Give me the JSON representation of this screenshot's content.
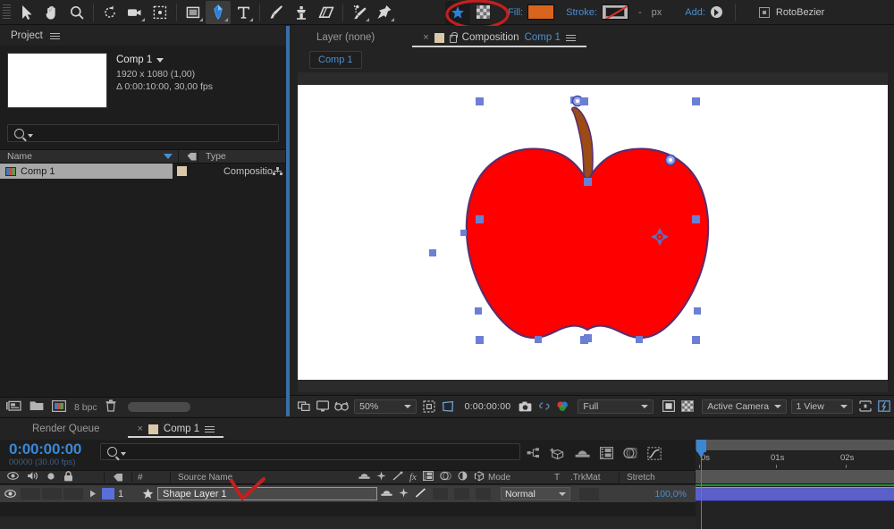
{
  "toolbar": {
    "tools": [
      {
        "name": "selection-tool",
        "icon": "arrow",
        "active": false
      },
      {
        "name": "hand-tool",
        "icon": "hand",
        "active": false
      },
      {
        "name": "zoom-tool",
        "icon": "magnifier",
        "active": false
      },
      {
        "name": "rotation-tool",
        "icon": "rotate",
        "active": false
      },
      {
        "name": "camera-tool",
        "icon": "camera",
        "active": false
      },
      {
        "name": "anchor-point-tool",
        "icon": "anchor-box",
        "active": false
      },
      {
        "name": "shape-tool",
        "icon": "rectangle",
        "active": false
      },
      {
        "name": "pen-tool",
        "icon": "pen",
        "active": true
      },
      {
        "name": "type-tool",
        "icon": "text-T",
        "active": false
      },
      {
        "name": "brush-tool",
        "icon": "brush",
        "active": false
      },
      {
        "name": "clone-stamp-tool",
        "icon": "stamp",
        "active": false
      },
      {
        "name": "eraser-tool",
        "icon": "eraser",
        "active": false
      },
      {
        "name": "roto-brush-tool",
        "icon": "roto-brush",
        "active": false
      },
      {
        "name": "puppet-pin-tool",
        "icon": "pin",
        "active": false
      }
    ],
    "star_icon": "star-icon",
    "grid_icon": "transparency-grid-icon",
    "fill_label": "Fill:",
    "fill_color": "#d9641e",
    "stroke_label": "Stroke:",
    "stroke_value": "-",
    "stroke_units": "px",
    "add_label": "Add:",
    "rotobezier_label": "RotoBezier",
    "accent_blue": "#4a8fd1",
    "annotation_color": "#c41f1f"
  },
  "project": {
    "title": "Project",
    "comp_name": "Comp 1",
    "resolution": "1920 x 1080 (1,00)",
    "duration": "Δ 0:00:10:00, 30,00 fps",
    "search_placeholder": "",
    "columns": [
      "Name",
      "Type"
    ],
    "rows": [
      {
        "name": "Comp 1",
        "type": "Compositio",
        "selected": true
      }
    ],
    "footer": {
      "bit_depth": "8 bpc"
    }
  },
  "composition": {
    "tabs": [
      {
        "label": "Layer (none)",
        "active": false
      },
      {
        "label_prefix": "Composition",
        "label": "Comp 1",
        "active": true
      }
    ],
    "breadcrumb": "Comp 1",
    "viewer": {
      "zoom": "50%",
      "timecode": "0:00:00:00",
      "resolution": "Full",
      "camera": "Active Camera",
      "views": "1 View"
    },
    "artwork": {
      "name": "apple-shape",
      "fill_color": "#ff0000",
      "stroke_color": "#5d2d6b",
      "stem_color": "#9c4a16",
      "vertex_color": "#6d7fd4",
      "handle_color": "#6d7fd4"
    }
  },
  "timeline": {
    "tabs": [
      {
        "label": "Render Queue",
        "active": false
      },
      {
        "label": "Comp 1",
        "active": true
      }
    ],
    "timecode": "0:00:00:00",
    "frames": "00000 (30.00 fps)",
    "search_placeholder": "",
    "columns": {
      "num": "#",
      "source_name": "Source Name",
      "mode": "Mode",
      "t": "T",
      "trkmat": ".TrkMat",
      "stretch": "Stretch"
    },
    "ruler_ticks": [
      "0s",
      "01s",
      "02s"
    ],
    "layers": [
      {
        "index": "1",
        "name": "Shape Layer 1",
        "mode": "Normal",
        "stretch": "100,0%",
        "editing": true,
        "color": "#5a6fd8"
      }
    ]
  }
}
